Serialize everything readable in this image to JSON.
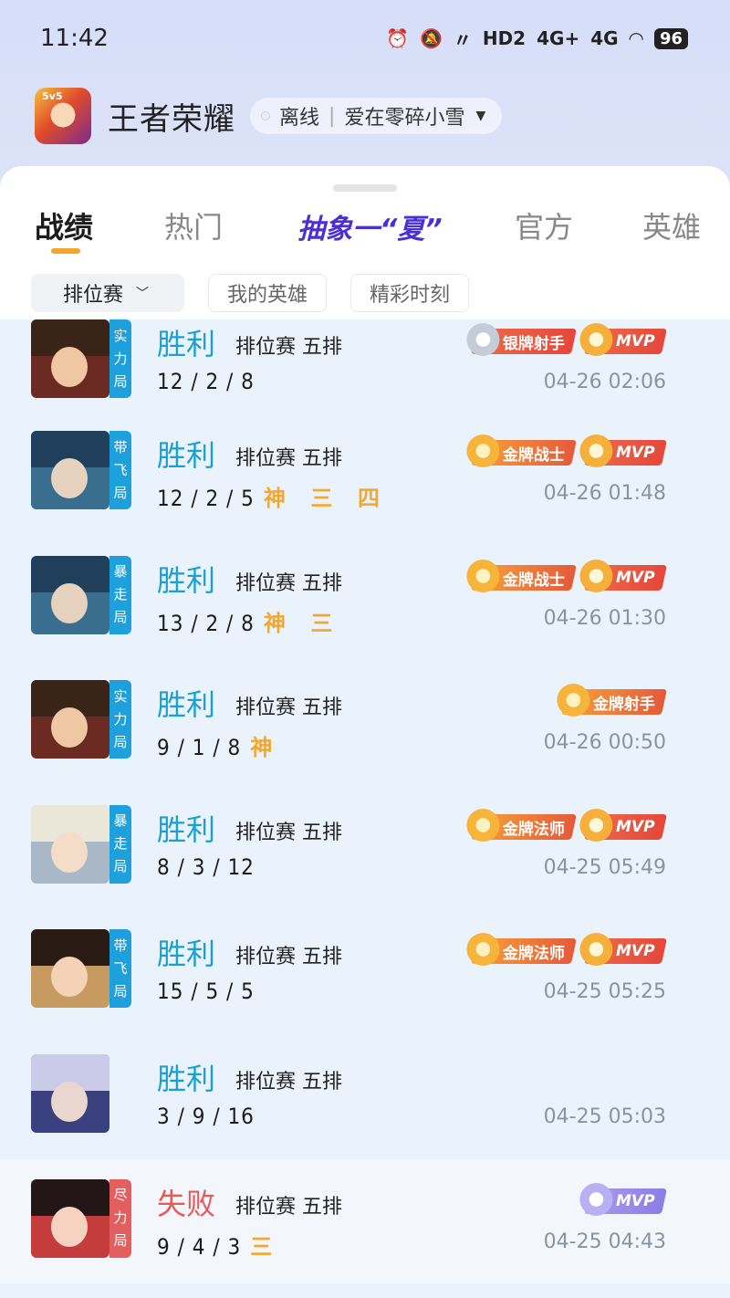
{
  "status_bar": {
    "time": "11:42",
    "signal1": "4G+",
    "signal2": "4G",
    "hd": "HD2",
    "battery": "96"
  },
  "app": {
    "title": "王者荣耀",
    "status": "离线",
    "player": "爱在零碎小雪"
  },
  "tabs": [
    {
      "label": "战绩",
      "active": true
    },
    {
      "label": "热门",
      "active": false
    },
    {
      "label": "抽象一“夏”",
      "active": false
    },
    {
      "label": "官方",
      "active": false
    },
    {
      "label": "英雄",
      "active": false
    }
  ],
  "filters": {
    "selected": "排位赛",
    "my_heroes": "我的英雄",
    "highlights": "精彩时刻"
  },
  "matches": [
    {
      "result": "胜利",
      "mode": "排位赛 五排",
      "kda": "12 / 2 / 8",
      "honors": "",
      "time": "04-26 02:06",
      "tag": "实力局",
      "badges": [
        {
          "text": "银牌射手",
          "type": "silver"
        },
        {
          "text": "MVP",
          "type": "mvp"
        }
      ]
    },
    {
      "result": "胜利",
      "mode": "排位赛 五排",
      "kda": "12 / 2 / 5",
      "honors": "神 三 四",
      "time": "04-26 01:48",
      "tag": "带飞局",
      "badges": [
        {
          "text": "金牌战士",
          "type": "gold"
        },
        {
          "text": "MVP",
          "type": "mvp"
        }
      ]
    },
    {
      "result": "胜利",
      "mode": "排位赛 五排",
      "kda": "13 / 2 / 8",
      "honors": "神 三",
      "time": "04-26 01:30",
      "tag": "暴走局",
      "badges": [
        {
          "text": "金牌战士",
          "type": "gold"
        },
        {
          "text": "MVP",
          "type": "mvp"
        }
      ]
    },
    {
      "result": "胜利",
      "mode": "排位赛 五排",
      "kda": "9 / 1 / 8",
      "honors": "神",
      "time": "04-26 00:50",
      "tag": "实力局",
      "badges": [
        {
          "text": "金牌射手",
          "type": "gold"
        }
      ]
    },
    {
      "result": "胜利",
      "mode": "排位赛 五排",
      "kda": "8 / 3 / 12",
      "honors": "",
      "time": "04-25 05:49",
      "tag": "暴走局",
      "badges": [
        {
          "text": "金牌法师",
          "type": "gold"
        },
        {
          "text": "MVP",
          "type": "mvp"
        }
      ]
    },
    {
      "result": "胜利",
      "mode": "排位赛 五排",
      "kda": "15 / 5 / 5",
      "honors": "",
      "time": "04-25 05:25",
      "tag": "带飞局",
      "badges": [
        {
          "text": "金牌法师",
          "type": "gold"
        },
        {
          "text": "MVP",
          "type": "mvp"
        }
      ]
    },
    {
      "result": "胜利",
      "mode": "排位赛 五排",
      "kda": "3 / 9 / 16",
      "honors": "",
      "time": "04-25 05:03",
      "tag": "",
      "badges": []
    },
    {
      "result": "失败",
      "mode": "排位赛 五排",
      "kda": "9 / 4 / 3",
      "honors": "三",
      "time": "04-25 04:43",
      "tag": "尽力局",
      "badges": [
        {
          "text": "MVP",
          "type": "mvp-loss"
        }
      ]
    }
  ],
  "colors": {
    "win": "#1aa0d3",
    "loss": "#e65a5a",
    "accent": "#f3a72e",
    "tab_special": "#4a2fd4"
  }
}
